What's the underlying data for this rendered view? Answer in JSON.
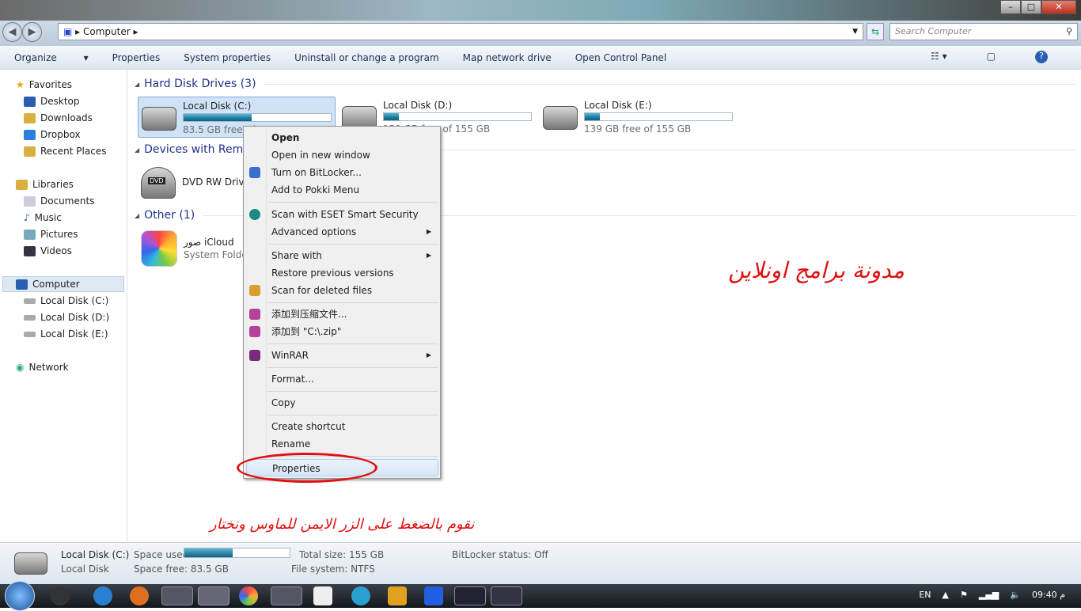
{
  "window": {
    "buttons": [
      "minimize",
      "maximize",
      "close"
    ]
  },
  "address": {
    "path": [
      "Computer"
    ],
    "search_placeholder": "Search Computer"
  },
  "toolbar": {
    "items": [
      "Organize",
      "Properties",
      "System properties",
      "Uninstall or change a program",
      "Map network drive",
      "Open Control Panel"
    ]
  },
  "sidebar": {
    "favorites": "Favorites",
    "fav_items": [
      "Desktop",
      "Downloads",
      "Dropbox",
      "Recent Places"
    ],
    "libraries": "Libraries",
    "lib_items": [
      "Documents",
      "Music",
      "Pictures",
      "Videos"
    ],
    "computer": "Computer",
    "comp_items": [
      "Local Disk (C:)",
      "Local Disk (D:)",
      "Local Disk (E:)"
    ],
    "network": "Network"
  },
  "groups": {
    "hdd": "Hard Disk Drives (3)",
    "removable": "Devices with Removable Storage",
    "other": "Other (1)"
  },
  "drives": [
    {
      "name": "Local Disk (C:)",
      "free": "83.5 GB free of 155 GB",
      "used_fraction": 0.46
    },
    {
      "name": "Local Disk (D:)",
      "free": "139 GB free of 155 GB",
      "used_fraction": 0.1
    },
    {
      "name": "Local Disk (E:)",
      "free": "139 GB free of 155 GB",
      "used_fraction": 0.1
    }
  ],
  "dvd": {
    "name": "DVD RW Drive",
    "label": "DVD"
  },
  "icloud": {
    "name": "صور iCloud",
    "type": "System Folder"
  },
  "context_menu": [
    "Open",
    "Open in new window",
    "Turn on BitLocker...",
    "Add to Pokki Menu",
    "Scan with ESET Smart Security",
    "Advanced options",
    "Share with",
    "Restore previous versions",
    "Scan for deleted files",
    "添加到压缩文件...",
    "添加到 \"C:\\.zip\"",
    "WinRAR",
    "Format...",
    "Copy",
    "Create shortcut",
    "Rename",
    "Properties"
  ],
  "annotations": {
    "blog": "مدونة برامج اونلاين",
    "instruction": "نقوم بالضغط على الزر الايمن للماوس ونختار"
  },
  "details": {
    "name": "Local Disk (C:)",
    "type": "Local Disk",
    "used_label": "Space used:",
    "free_label": "Space free: 83.5 GB",
    "total": "Total size: 155 GB",
    "fs": "File system: NTFS",
    "bitlocker": "BitLocker status: Off",
    "used_fraction": 0.46
  },
  "taskbar": {
    "lang": "EN",
    "time": "09:40 م"
  },
  "colors": {
    "accent": "#1e3287",
    "annotation": "#e01010"
  }
}
